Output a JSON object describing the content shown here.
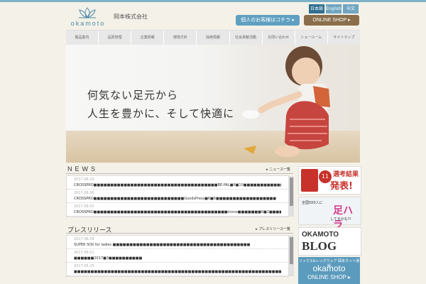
{
  "header": {
    "logo_text": "okamoto",
    "company": "岡本株式会社",
    "lang": [
      "日本語",
      "English",
      "中文"
    ],
    "personal_btn": "個人のお客様はコチラ ▸",
    "shop_btn": "ONLINE SHOP ▸"
  },
  "nav": [
    "製品案内",
    "品質管理",
    "企業情報",
    "環境方針",
    "採用情報",
    "社会貢献活動",
    "お問い合わせ",
    "ショールーム",
    "サイトマップ"
  ],
  "hero": {
    "line1": "何気ない足元から",
    "line2": "人生を豊かに、そして快適に"
  },
  "news": {
    "title": "NEWS",
    "more": "▸ ニュース一覧",
    "items": [
      {
        "date": "2017.06.10",
        "text": "CROSSPRO■■■■■■■■■■■■■■■■■■■■■■■■■■■■■■■■■■■■■BE-PAL■6■10■■■■■■■■■■■■■■■■■■"
      },
      {
        "date": "2017.06.06",
        "text": "CROSSPRO■■■■■■■■■■■■■■■■■■■■■■■■■■■GoodsPress■6■6■■■■■■■■■■■■■■■■■■"
      },
      {
        "date": "2017.06.02",
        "text": "CROSSPRO■■■■■■■■■■■■■■■■■■■■■■■■■■■■■■■■■■■■■■■■mono■■■■■■■6■2■■■■■■■■■■■■■■■■■■"
      }
    ]
  },
  "press": {
    "title": "プレスリリース",
    "more": "▸ プレスリリース一覧",
    "items": [
      {
        "date": "2017.06.08",
        "text": "SUPER SOX for ladies ■■■■■■■■■■■■■■■■■■■■■■■■■■■■■■■■■■■■■■■■■"
      },
      {
        "date": "2017.06.01",
        "text": "■■■■■■2017■3■■■■■■■■■■"
      },
      {
        "date": "2017.05.25",
        "text": "■■■■■■■■■■■■■■■■■■■■■■■■■■■■■■■■■■■■■■■■■■■■■■■■■■■■■■■■■■■■■■■■■■■■■■■■■■■■"
      }
    ]
  },
  "side": {
    "b1_num": "11",
    "b1_t1": "選考結果",
    "b1_t2": "発表!",
    "b2_t1": "全国500人に",
    "b2_t2": "足ハラ",
    "b2_t3": "してるかも?!",
    "b3_t1": "OKAMOTO",
    "b3_t2": "BLOG",
    "b4_t1": "ソックス&レッグウェア 岡本ネット通販",
    "b4_t2": "okamoto",
    "b4_t3": "ONLINE SHOP ▸"
  }
}
